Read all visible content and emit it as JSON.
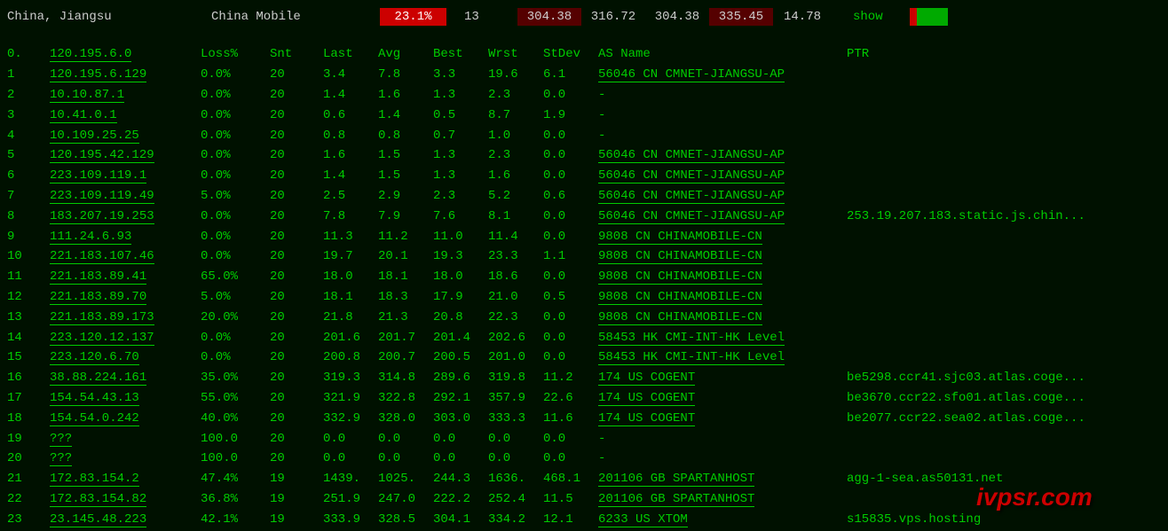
{
  "header": {
    "location": "China, Jiangsu",
    "isp": "China Mobile",
    "loss": "23.1%",
    "snt": "13",
    "stats": [
      "304.38",
      "316.72",
      "304.38",
      "335.45"
    ],
    "stdev": "14.78",
    "show": "show"
  },
  "columns": {
    "num": "0.",
    "ip": "120.195.6.0",
    "loss": "Loss%",
    "snt": "Snt",
    "last": "Last",
    "avg": "Avg",
    "best": "Best",
    "wrst": "Wrst",
    "stdev": "StDev",
    "asn": "AS Name",
    "ptr": "PTR"
  },
  "rows": [
    {
      "n": "1",
      "ip": "120.195.6.129",
      "loss": "0.0%",
      "snt": "20",
      "last": "3.4",
      "avg": "7.8",
      "best": "3.3",
      "wrst": "19.6",
      "stdev": "6.1",
      "asn": "56046 CN CMNET-JIANGSU-AP",
      "ptr": ""
    },
    {
      "n": "2",
      "ip": "10.10.87.1",
      "loss": "0.0%",
      "snt": "20",
      "last": "1.4",
      "avg": "1.6",
      "best": "1.3",
      "wrst": "2.3",
      "stdev": "0.0",
      "asn": "-",
      "ptr": ""
    },
    {
      "n": "3",
      "ip": "10.41.0.1",
      "loss": "0.0%",
      "snt": "20",
      "last": "0.6",
      "avg": "1.4",
      "best": "0.5",
      "wrst": "8.7",
      "stdev": "1.9",
      "asn": "-",
      "ptr": ""
    },
    {
      "n": "4",
      "ip": "10.109.25.25",
      "loss": "0.0%",
      "snt": "20",
      "last": "0.8",
      "avg": "0.8",
      "best": "0.7",
      "wrst": "1.0",
      "stdev": "0.0",
      "asn": "-",
      "ptr": ""
    },
    {
      "n": "5",
      "ip": "120.195.42.129",
      "loss": "0.0%",
      "snt": "20",
      "last": "1.6",
      "avg": "1.5",
      "best": "1.3",
      "wrst": "2.3",
      "stdev": "0.0",
      "asn": "56046 CN CMNET-JIANGSU-AP",
      "ptr": ""
    },
    {
      "n": "6",
      "ip": "223.109.119.1",
      "loss": "0.0%",
      "snt": "20",
      "last": "1.4",
      "avg": "1.5",
      "best": "1.3",
      "wrst": "1.6",
      "stdev": "0.0",
      "asn": "56046 CN CMNET-JIANGSU-AP",
      "ptr": ""
    },
    {
      "n": "7",
      "ip": "223.109.119.49",
      "loss": "5.0%",
      "snt": "20",
      "last": "2.5",
      "avg": "2.9",
      "best": "2.3",
      "wrst": "5.2",
      "stdev": "0.6",
      "asn": "56046 CN CMNET-JIANGSU-AP",
      "ptr": ""
    },
    {
      "n": "8",
      "ip": "183.207.19.253",
      "loss": "0.0%",
      "snt": "20",
      "last": "7.8",
      "avg": "7.9",
      "best": "7.6",
      "wrst": "8.1",
      "stdev": "0.0",
      "asn": "56046 CN CMNET-JIANGSU-AP",
      "ptr": "253.19.207.183.static.js.chin..."
    },
    {
      "n": "9",
      "ip": "111.24.6.93",
      "loss": "0.0%",
      "snt": "20",
      "last": "11.3",
      "avg": "11.2",
      "best": "11.0",
      "wrst": "11.4",
      "stdev": "0.0",
      "asn": "9808  CN CHINAMOBILE-CN",
      "ptr": ""
    },
    {
      "n": "10",
      "ip": "221.183.107.46",
      "loss": "0.0%",
      "snt": "20",
      "last": "19.7",
      "avg": "20.1",
      "best": "19.3",
      "wrst": "23.3",
      "stdev": "1.1",
      "asn": "9808  CN CHINAMOBILE-CN",
      "ptr": ""
    },
    {
      "n": "11",
      "ip": "221.183.89.41",
      "loss": "65.0%",
      "snt": "20",
      "last": "18.0",
      "avg": "18.1",
      "best": "18.0",
      "wrst": "18.6",
      "stdev": "0.0",
      "asn": "9808  CN CHINAMOBILE-CN",
      "ptr": ""
    },
    {
      "n": "12",
      "ip": "221.183.89.70",
      "loss": "5.0%",
      "snt": "20",
      "last": "18.1",
      "avg": "18.3",
      "best": "17.9",
      "wrst": "21.0",
      "stdev": "0.5",
      "asn": "9808  CN CHINAMOBILE-CN",
      "ptr": ""
    },
    {
      "n": "13",
      "ip": "221.183.89.173",
      "loss": "20.0%",
      "snt": "20",
      "last": "21.8",
      "avg": "21.3",
      "best": "20.8",
      "wrst": "22.3",
      "stdev": "0.0",
      "asn": "9808  CN CHINAMOBILE-CN",
      "ptr": ""
    },
    {
      "n": "14",
      "ip": "223.120.12.137",
      "loss": "0.0%",
      "snt": "20",
      "last": "201.6",
      "avg": "201.7",
      "best": "201.4",
      "wrst": "202.6",
      "stdev": "0.0",
      "asn": "58453 HK CMI-INT-HK Level",
      "ptr": ""
    },
    {
      "n": "15",
      "ip": "223.120.6.70",
      "loss": "0.0%",
      "snt": "20",
      "last": "200.8",
      "avg": "200.7",
      "best": "200.5",
      "wrst": "201.0",
      "stdev": "0.0",
      "asn": "58453 HK CMI-INT-HK Level",
      "ptr": ""
    },
    {
      "n": "16",
      "ip": "38.88.224.161",
      "loss": "35.0%",
      "snt": "20",
      "last": "319.3",
      "avg": "314.8",
      "best": "289.6",
      "wrst": "319.8",
      "stdev": "11.2",
      "asn": "174   US COGENT",
      "ptr": "be5298.ccr41.sjc03.atlas.coge..."
    },
    {
      "n": "17",
      "ip": "154.54.43.13",
      "loss": "55.0%",
      "snt": "20",
      "last": "321.9",
      "avg": "322.8",
      "best": "292.1",
      "wrst": "357.9",
      "stdev": "22.6",
      "asn": "174   US COGENT",
      "ptr": "be3670.ccr22.sfo01.atlas.coge..."
    },
    {
      "n": "18",
      "ip": "154.54.0.242",
      "loss": "40.0%",
      "snt": "20",
      "last": "332.9",
      "avg": "328.0",
      "best": "303.0",
      "wrst": "333.3",
      "stdev": "11.6",
      "asn": "174   US COGENT",
      "ptr": "be2077.ccr22.sea02.atlas.coge..."
    },
    {
      "n": "19",
      "ip": "???",
      "loss": "100.0",
      "snt": "20",
      "last": "0.0",
      "avg": "0.0",
      "best": "0.0",
      "wrst": "0.0",
      "stdev": "0.0",
      "asn": "-",
      "ptr": ""
    },
    {
      "n": "20",
      "ip": "???",
      "loss": "100.0",
      "snt": "20",
      "last": "0.0",
      "avg": "0.0",
      "best": "0.0",
      "wrst": "0.0",
      "stdev": "0.0",
      "asn": "-",
      "ptr": ""
    },
    {
      "n": "21",
      "ip": "172.83.154.2",
      "loss": "47.4%",
      "snt": "19",
      "last": "1439.",
      "avg": "1025.",
      "best": "244.3",
      "wrst": "1636.",
      "stdev": "468.1",
      "asn": "201106 GB SPARTANHOST",
      "ptr": "agg-1-sea.as50131.net"
    },
    {
      "n": "22",
      "ip": "172.83.154.82",
      "loss": "36.8%",
      "snt": "19",
      "last": "251.9",
      "avg": "247.0",
      "best": "222.2",
      "wrst": "252.4",
      "stdev": "11.5",
      "asn": "201106 GB SPARTANHOST",
      "ptr": ""
    },
    {
      "n": "23",
      "ip": "23.145.48.223",
      "loss": "42.1%",
      "snt": "19",
      "last": "333.9",
      "avg": "328.5",
      "best": "304.1",
      "wrst": "334.2",
      "stdev": "12.1",
      "asn": "6233  US XTOM",
      "ptr": "s15835.vps.hosting"
    }
  ],
  "watermark": "ivpsr.com"
}
